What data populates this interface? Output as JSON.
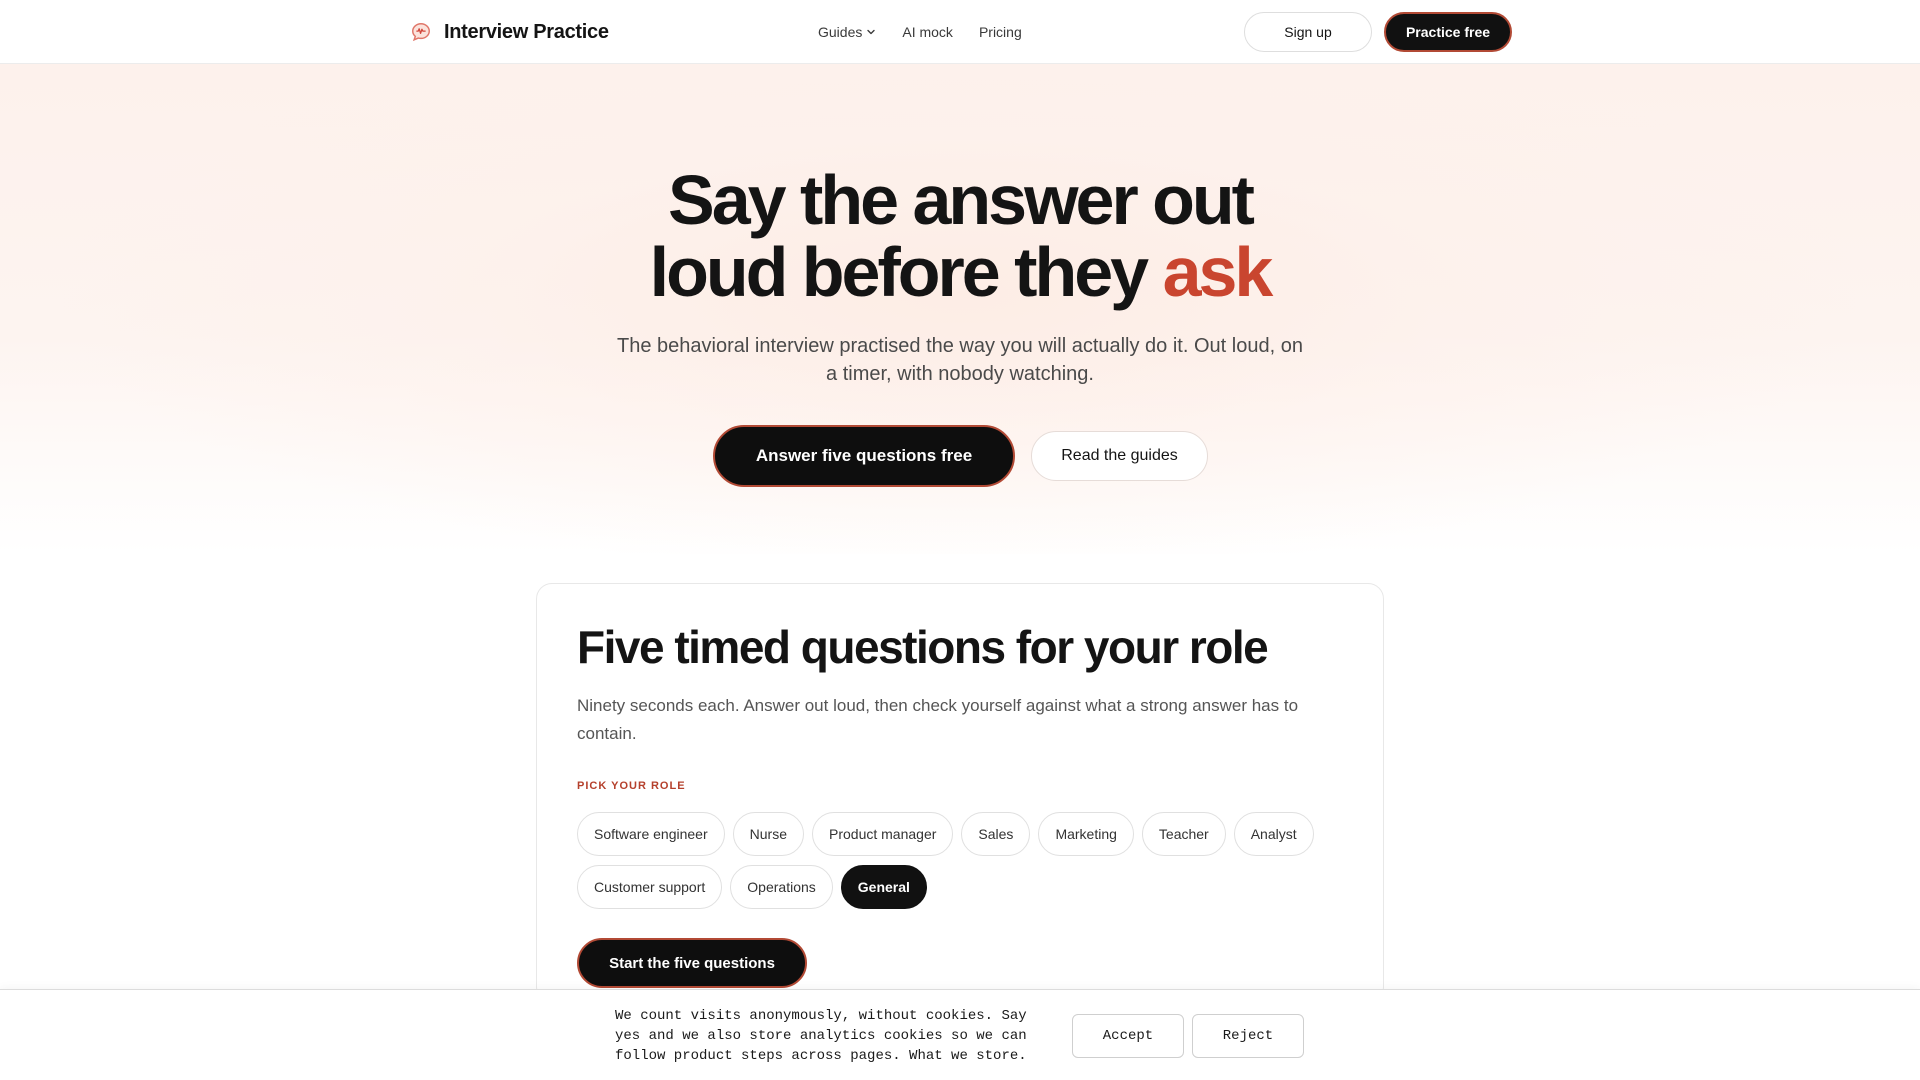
{
  "header": {
    "brand_name": "Interview Practice",
    "brand_icon": "speech-bubble-waveform-icon",
    "nav": {
      "guides": "Guides",
      "ai_mock": "AI mock",
      "pricing": "Pricing"
    },
    "signup_label": "Sign up",
    "practice_label": "Practice free"
  },
  "hero": {
    "title_line1": "Say the answer out",
    "title_line2_start": "loud before they",
    "title_accent": "ask",
    "subtitle": "The behavioral interview practised the way you will actually do it. Out loud, on a timer, with nobody watching.",
    "primary_cta": "Answer five questions free",
    "secondary_cta": "Read the guides"
  },
  "card": {
    "title": "Five timed questions for your role",
    "subtitle": "Ninety seconds each. Answer out loud, then check yourself against what a strong answer has to contain.",
    "role_label": "PICK YOUR ROLE",
    "roles_row1": [
      "Software engineer",
      "Nurse",
      "Product manager",
      "Sales",
      "Marketing",
      "Teacher",
      "Analyst"
    ],
    "roles_row2": [
      "Customer support",
      "Operations",
      "General"
    ],
    "selected_role": "General",
    "start_label": "Start the five questions"
  },
  "cookie": {
    "text": "We count visits anonymously, without cookies. Say yes and we also store analytics cookies so we can follow product steps across pages. What we store.",
    "accept_label": "Accept",
    "reject_label": "Reject"
  },
  "colors": {
    "accent": "#c9452f",
    "dark_button": "#0e0e0e",
    "button_border": "#b24a35",
    "label_red": "#b5402c"
  }
}
